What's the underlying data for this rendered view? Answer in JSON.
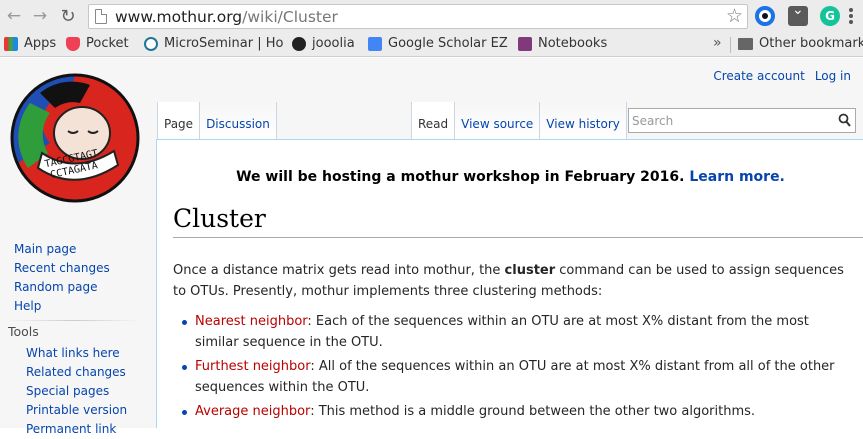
{
  "browser": {
    "url_domain": "www.mothur.org",
    "url_path": "/wiki/Cluster",
    "bookmarks": [
      {
        "label": "Apps"
      },
      {
        "label": "Pocket"
      },
      {
        "label": "MicroSeminar | Ho"
      },
      {
        "label": "jooolia"
      },
      {
        "label": "Google Scholar EZ"
      },
      {
        "label": "Notebooks"
      }
    ],
    "more_bookmarks": "»",
    "other_bookmarks": "Other bookmark",
    "extension_letter": "G"
  },
  "personal": {
    "create_account": "Create account",
    "log_in": "Log in"
  },
  "tabs": {
    "page": "Page",
    "discussion": "Discussion",
    "read": "Read",
    "view_source": "View source",
    "view_history": "View history"
  },
  "search": {
    "placeholder": "Search"
  },
  "notice": {
    "text": "We will be hosting a mothur workshop in February 2016.",
    "link": "Learn more."
  },
  "article": {
    "title": "Cluster",
    "intro_before": "Once a distance matrix gets read into mothur, the ",
    "intro_bold": "cluster",
    "intro_after": " command can be used to assign sequences to OTUs. Presently, mothur implements three clustering methods:",
    "methods": [
      {
        "name": "Nearest neighbor",
        "desc": ": Each of the sequences within an OTU are at most X% distant from the most similar sequence in the OTU."
      },
      {
        "name": "Furthest neighbor",
        "desc": ": All of the sequences within an OTU are at most X% distant from all of the other sequences within the OTU."
      },
      {
        "name": "Average neighbor",
        "desc": ": This method is a middle ground between the other two algorithms."
      }
    ]
  },
  "sidebar": {
    "main": [
      "Main page",
      "Recent changes",
      "Random page",
      "Help"
    ],
    "tools_heading": "Tools",
    "tools": [
      "What links here",
      "Related changes",
      "Special pages",
      "Printable version",
      "Permanent link"
    ]
  },
  "logo": {
    "seq1": "TAGCGTAGT",
    "seq2": "CCTAGATA"
  }
}
